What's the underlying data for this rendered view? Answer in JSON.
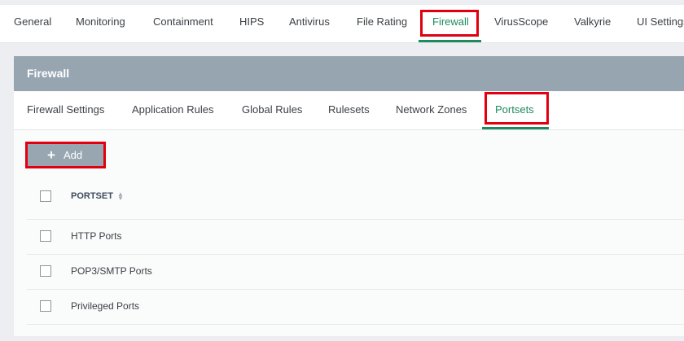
{
  "top_tabs": [
    {
      "label": "General"
    },
    {
      "label": "Monitoring"
    },
    {
      "label": "Containment"
    },
    {
      "label": "HIPS"
    },
    {
      "label": "Antivirus"
    },
    {
      "label": "File Rating"
    },
    {
      "label": "Firewall",
      "active": true
    },
    {
      "label": "VirusScope"
    },
    {
      "label": "Valkyrie"
    },
    {
      "label": "UI Settings"
    }
  ],
  "panel": {
    "title": "Firewall"
  },
  "sub_tabs": [
    {
      "label": "Firewall Settings"
    },
    {
      "label": "Application Rules"
    },
    {
      "label": "Global Rules"
    },
    {
      "label": "Rulesets"
    },
    {
      "label": "Network Zones"
    },
    {
      "label": "Portsets",
      "active": true
    }
  ],
  "toolbar": {
    "add_icon": "plus-icon",
    "add_label": "Add"
  },
  "table": {
    "column_header": "PORTSET",
    "sort_icon": "sort-icon",
    "rows": [
      {
        "name": "HTTP Ports"
      },
      {
        "name": "POP3/SMTP Ports"
      },
      {
        "name": "Privileged Ports"
      }
    ]
  },
  "colors": {
    "accent": "#1e8a5f",
    "header_bg": "#97a5b1",
    "highlight": "#e0000f"
  }
}
